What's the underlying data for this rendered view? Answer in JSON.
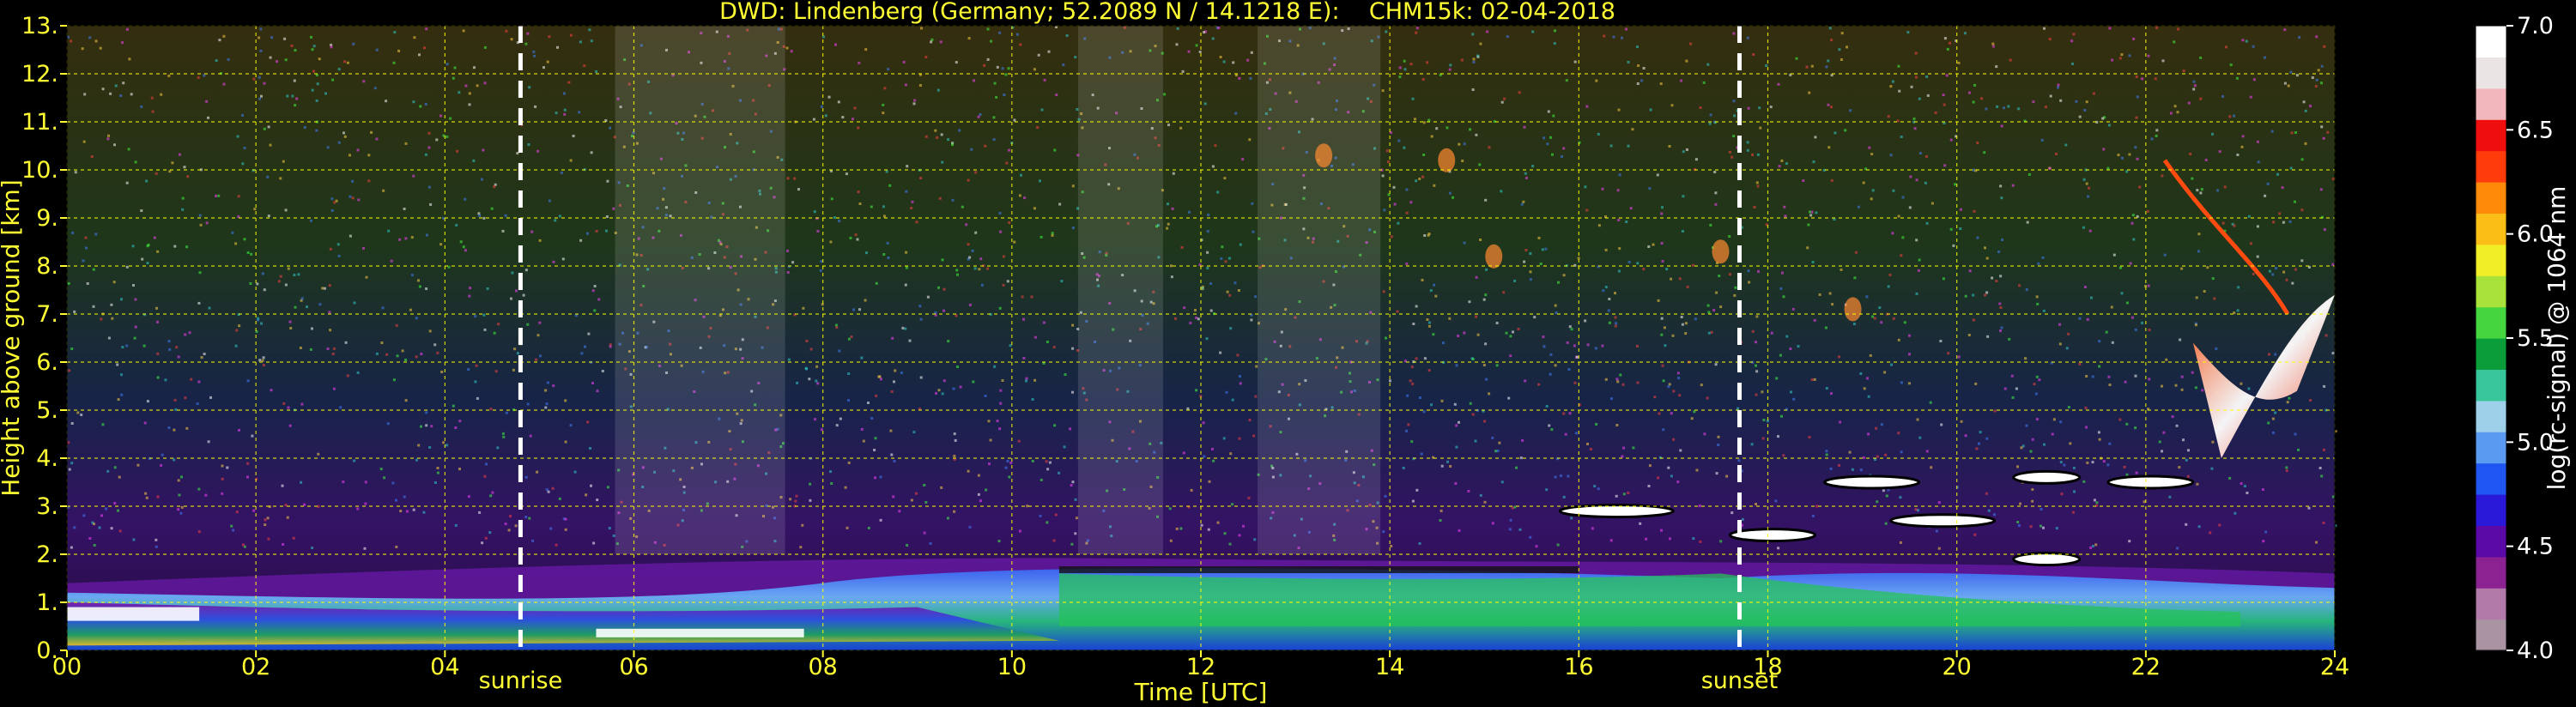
{
  "chart_data": {
    "type": "heatmap",
    "title": "DWD: Lindenberg (Germany; 52.2089 N / 14.1218 E):    CHM15k: 02-04-2018",
    "xlabel": "Time [UTC]",
    "ylabel": "Height above ground [km]",
    "colorbar_label": "log(rc-signal) @ 1064 nm",
    "xlim": [
      0,
      24
    ],
    "ylim": [
      0,
      13
    ],
    "x_ticks": [
      "00",
      "02",
      "04",
      "06",
      "08",
      "10",
      "12",
      "14",
      "16",
      "18",
      "20",
      "22",
      "24"
    ],
    "y_ticks": [
      "0.",
      "1.",
      "2.",
      "3.",
      "4.",
      "5.",
      "6.",
      "7.",
      "8.",
      "9.",
      "10.",
      "11.",
      "12.",
      "13."
    ],
    "colorbar_range": [
      4.0,
      7.0
    ],
    "colorbar_ticks": [
      "4.0",
      "4.5",
      "5.0",
      "5.5",
      "6.0",
      "6.5",
      "7.0"
    ],
    "grid": true,
    "markers": [
      {
        "label": "sunrise",
        "time": 4.8
      },
      {
        "label": "sunset",
        "time": 17.7
      }
    ],
    "cloud_layers": [
      {
        "t_start": 15.8,
        "t_end": 17.0,
        "height_km": 2.9
      },
      {
        "t_start": 17.6,
        "t_end": 18.5,
        "height_km": 2.4
      },
      {
        "t_start": 18.6,
        "t_end": 19.6,
        "height_km": 3.5
      },
      {
        "t_start": 19.3,
        "t_end": 20.4,
        "height_km": 2.7
      },
      {
        "t_start": 20.6,
        "t_end": 21.3,
        "height_km": 3.6
      },
      {
        "t_start": 21.6,
        "t_end": 22.5,
        "height_km": 3.5
      },
      {
        "t_start": 20.6,
        "t_end": 21.3,
        "height_km": 1.9
      },
      {
        "t_start": 22.5,
        "t_end": 24.0,
        "height_km": 5.5
      }
    ]
  },
  "colors": {
    "text": "#ffff33",
    "grid": "#ffff00",
    "marker": "#ffffff",
    "background": "#000000",
    "colorbar": [
      "#aa93a3",
      "#b27aa8",
      "#8c2291",
      "#5a08a6",
      "#2a18d8",
      "#1f55f0",
      "#5a9af0",
      "#9ed0ea",
      "#37c59a",
      "#0a9d3a",
      "#45d63f",
      "#a9e23b",
      "#f0ee26",
      "#fbbe17",
      "#ff8a0a",
      "#ff3c0a",
      "#ee0e0e",
      "#f2b7bd",
      "#ebe4e4",
      "#ffffff"
    ]
  }
}
